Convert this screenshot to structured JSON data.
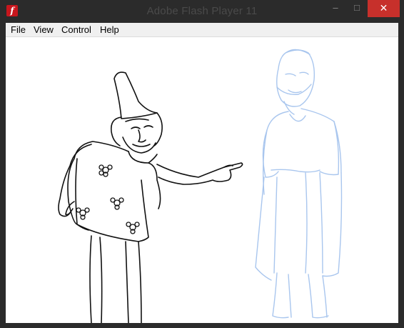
{
  "window": {
    "title": "Adobe Flash Player 11",
    "app_icon_glyph": "f",
    "controls": {
      "minimize": "–",
      "maximize": "□",
      "close": "✕"
    }
  },
  "menu": [
    "File",
    "View",
    "Control",
    "Help"
  ],
  "icons": [
    "flash-player-icon",
    "minimize-icon",
    "maximize-icon",
    "close-icon"
  ],
  "colors": {
    "frame": "#2b2b2b",
    "close": "#c7302b",
    "sketch_blue": "#a9c6ee",
    "ink": "#111111"
  }
}
